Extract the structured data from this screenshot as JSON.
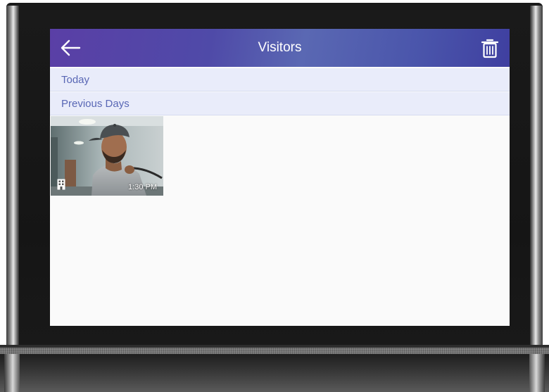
{
  "header": {
    "title": "Visitors",
    "back_icon": "arrow-left-icon",
    "trash_icon": "trash-icon",
    "gradient_colors": [
      "#5a3fa6",
      "#5a68b3",
      "#3f3fa0"
    ]
  },
  "sections": {
    "today_label": "Today",
    "previous_label": "Previous Days",
    "label_color": "#5967b5",
    "background": "#e9ecfa"
  },
  "visitors": [
    {
      "time": "1:30 PM",
      "source_icon": "building-icon"
    }
  ]
}
